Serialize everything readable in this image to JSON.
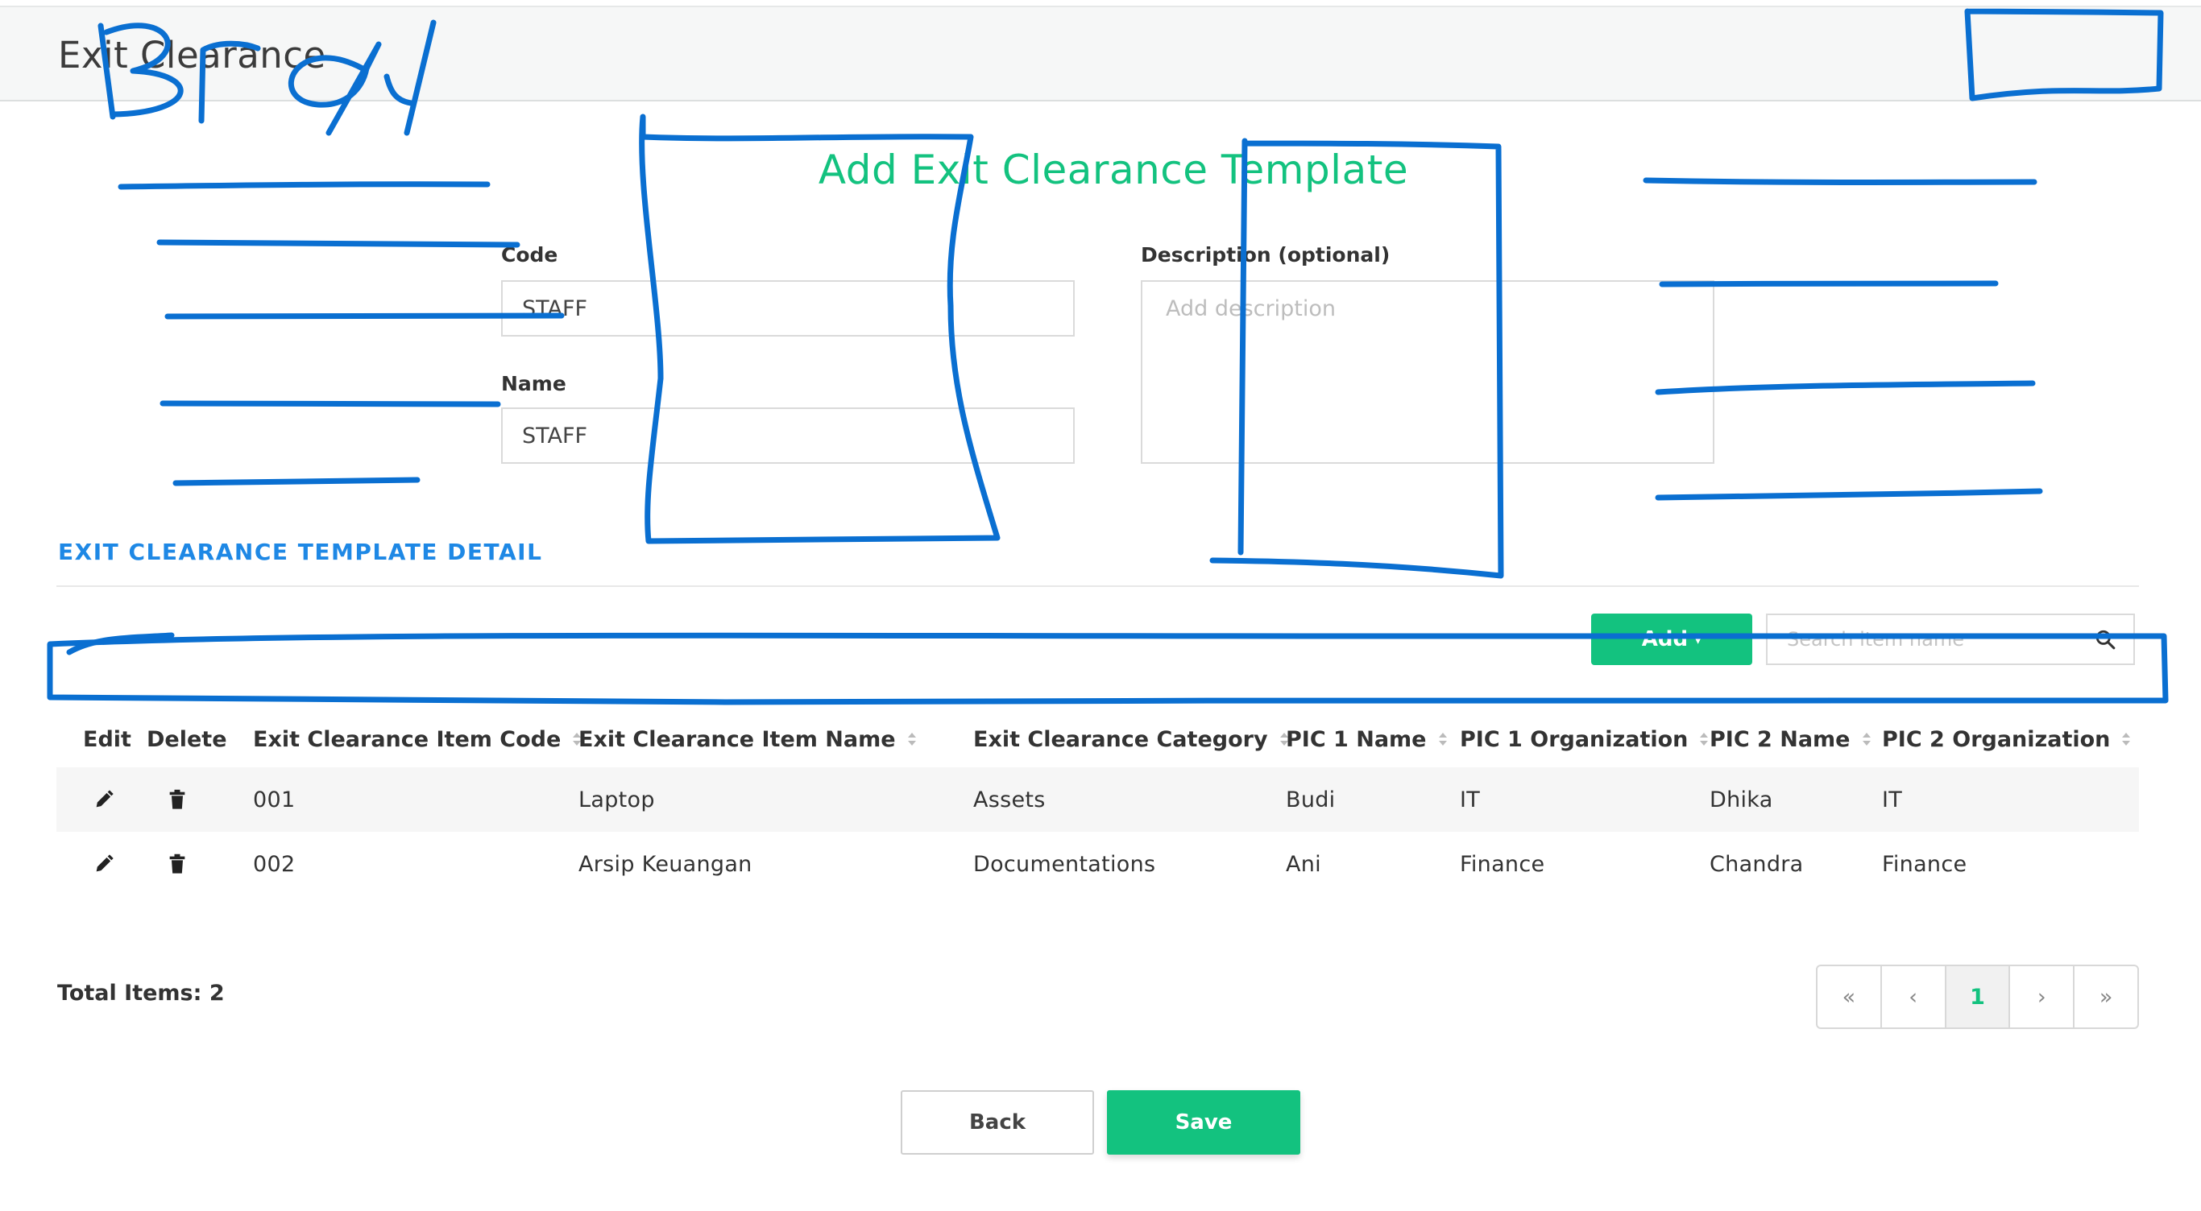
{
  "header": {
    "title": "Exit Clearance"
  },
  "form": {
    "title": "Add Exit Clearance Template",
    "code_label": "Code",
    "code_value": "STAFF",
    "name_label": "Name",
    "name_value": "STAFF",
    "description_label": "Description (optional)",
    "description_placeholder": "Add description"
  },
  "detail": {
    "section_title": "EXIT CLEARANCE TEMPLATE DETAIL",
    "add_label": "Add",
    "add_caret": "▾",
    "search_placeholder": "Search item name"
  },
  "table": {
    "columns": [
      "Edit",
      "Delete",
      "Exit Clearance Item Code",
      "Exit Clearance Item Name",
      "Exit Clearance Category",
      "PIC 1 Name",
      "PIC 1 Organization",
      "PIC 2 Name",
      "PIC 2 Organization"
    ],
    "rows": [
      {
        "code": "001",
        "name": "Laptop",
        "category": "Assets",
        "pic1_name": "Budi",
        "pic1_org": "IT",
        "pic2_name": "Dhika",
        "pic2_org": "IT"
      },
      {
        "code": "002",
        "name": "Arsip Keuangan",
        "category": "Documentations",
        "pic1_name": "Ani",
        "pic1_org": "Finance",
        "pic2_name": "Chandra",
        "pic2_org": "Finance"
      }
    ]
  },
  "footer": {
    "total_label": "Total Items: 2",
    "pagination": {
      "first": "«",
      "prev": "‹",
      "current": "1",
      "next": "›",
      "last": "»"
    },
    "back_label": "Back",
    "save_label": "Save"
  },
  "icons": {
    "edit": "pencil-icon",
    "delete": "trash-icon",
    "search": "search-icon",
    "sort": "sort-icon"
  },
  "colors": {
    "accent_green": "#13c27f",
    "section_blue": "#1e88e5",
    "annotation_blue": "#0a6fd1"
  }
}
